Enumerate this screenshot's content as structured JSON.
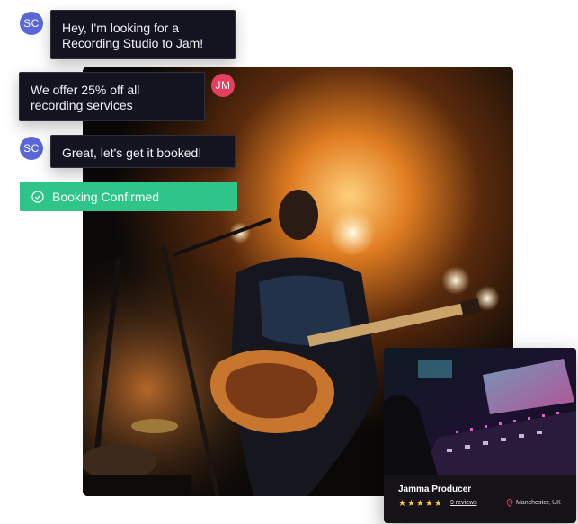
{
  "chat": {
    "messages": [
      {
        "sender_initials": "SC",
        "text_line1": "Hey, I'm looking for a",
        "text_line2": "Recording Studio to Jam!"
      },
      {
        "sender_initials": "JM",
        "text_line1": "We offer 25% off all",
        "text_line2": "recording services"
      },
      {
        "sender_initials": "SC",
        "text": "Great, let's get it booked!"
      }
    ],
    "status": {
      "label": "Booking Confirmed",
      "icon": "check-circle-icon",
      "color": "#2fc58a"
    }
  },
  "hero_photo": {
    "icon": "concert-guitarist-photo"
  },
  "producer_card": {
    "name": "Jamma Producer",
    "rating_stars": "★★★★★",
    "rating": 5,
    "reviews": "9 reviews",
    "location": "Manchester, UK",
    "image_icon": "mixing-console-photo"
  },
  "colors": {
    "avatar_sc": "#5a67d8",
    "avatar_jm": "#e53e5e",
    "bubble_bg": "#141420",
    "confirm_bg": "#2fc58a"
  }
}
